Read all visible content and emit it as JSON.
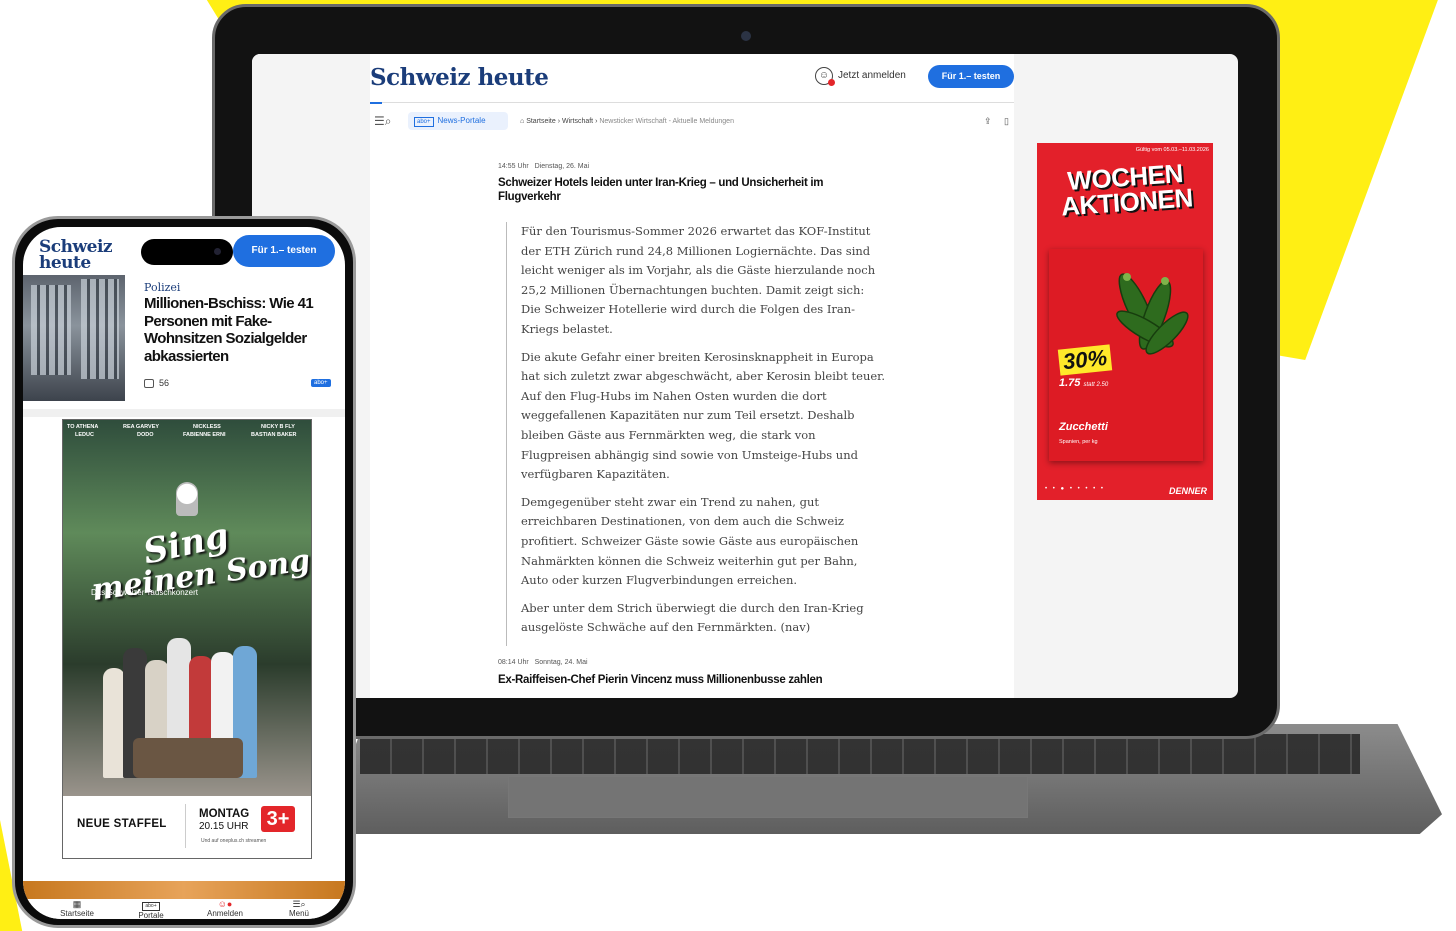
{
  "colors": {
    "brand": "#1b3d7a",
    "accent": "#1f6fe0",
    "yellow": "#ffef14",
    "ad_red": "#e3202a"
  },
  "desktop": {
    "logo": "Schweiz heute",
    "header": {
      "login_label": "Jetzt anmelden",
      "cta_label": "Für 1.– testen",
      "user_icon": "user-icon"
    },
    "nav": {
      "menu_icon": "menu-search-icon",
      "portal_tag": "abo+",
      "portal_label": "News-Portale",
      "breadcrumb": {
        "home": "Startseite",
        "section": "Wirtschaft",
        "current": "Newsticker Wirtschaft - Aktuelle Meldungen"
      },
      "share_icon": "share-icon",
      "bookmark_icon": "bookmark-icon"
    },
    "ticker": [
      {
        "time": "14:55 Uhr",
        "date": "Dienstag, 26. Mai",
        "title": "Schweizer Hotels leiden unter Iran-Krieg – und Unsicherheit im Flugverkehr",
        "paragraphs": [
          "Für den Tourismus-Sommer 2026 erwartet das KOF-Institut der ETH Zürich rund 24,8 Millionen Logiernächte. Das sind leicht weniger als im Vorjahr, als die Gäste hierzulande noch 25,2 Millionen Übernachtungen buchten. Damit zeigt sich: Die Schweizer Hotellerie wird durch die Folgen des Iran-Kriegs belastet.",
          "Die akute Gefahr einer breiten Kerosinsknappheit in Europa hat sich zuletzt zwar abgeschwächt, aber Kerosin bleibt teuer. Auf den Flug-Hubs im Nahen Osten wurden die dort weggefallenen Kapazitäten nur zum Teil ersetzt. Deshalb bleiben Gäste aus Fernmärkten weg, die stark von Flugpreisen abhängig sind sowie von Umsteige-Hubs und verfügbaren Kapazitäten.",
          "Demgegenüber steht zwar ein Trend zu nahen, gut erreichbaren Destinationen, von dem auch die Schweiz profitiert. Schweizer Gäste sowie Gäste aus europäischen Nahmärkten können die Schweiz weiterhin gut per Bahn, Auto oder kurzen Flugverbindungen erreichen.",
          "Aber unter dem Strich überwiegt die durch den Iran-Krieg ausgelöste Schwäche auf den Fernmärkten. (nav)"
        ]
      },
      {
        "time": "08:14 Uhr",
        "date": "Sonntag, 24. Mai",
        "title": "Ex-Raiffeisen-Chef Pierin Vincenz muss Millionenbusse zahlen"
      }
    ],
    "ad": {
      "validity": "Gültig vom 05.03.–11.03.2026",
      "headline_1": "WOCHEN",
      "headline_2": "AKTIONEN",
      "discount": "30%",
      "price": "1.75",
      "price_old": "statt 2.50",
      "product": "Zucchetti",
      "origin": "Spanien, per kg",
      "brand": "DENNER",
      "dots": "• • ● • • • • •"
    }
  },
  "mobile": {
    "logo": "Schweiz heute",
    "cta_label": "Für 1.– testen",
    "teaser": {
      "kicker": "Polizei",
      "title": "Millionen-Bschiss: Wie 41 Personen mit Fake-Wohnsitzen Sozialgelder abkassierten",
      "comments": "56",
      "badge": "abo+"
    },
    "promo": {
      "credits": [
        "TO ATHENA",
        "REA GARVEY",
        "NICKLESS",
        "NICKY B FLY",
        "LEDUC",
        "DODO",
        "FABIENNE ERNI",
        "BASTIAN BAKER"
      ],
      "logo_line_1": "Sing",
      "logo_line_2": "meinen Song",
      "tagline": "Das Schweizer Tauschkonzert",
      "footer_label": "NEUE STAFFEL",
      "day": "MONTAG",
      "time": "20.15 UHR",
      "stream": "Und auf oneplus.ch streamen",
      "channel": "3+"
    },
    "tabbar": [
      {
        "label": "Startseite",
        "icon": "home-icon"
      },
      {
        "label": "Portale",
        "icon": "abo+"
      },
      {
        "label": "Anmelden",
        "icon": "user-icon"
      },
      {
        "label": "Menü",
        "icon": "menu-search-icon"
      }
    ]
  }
}
